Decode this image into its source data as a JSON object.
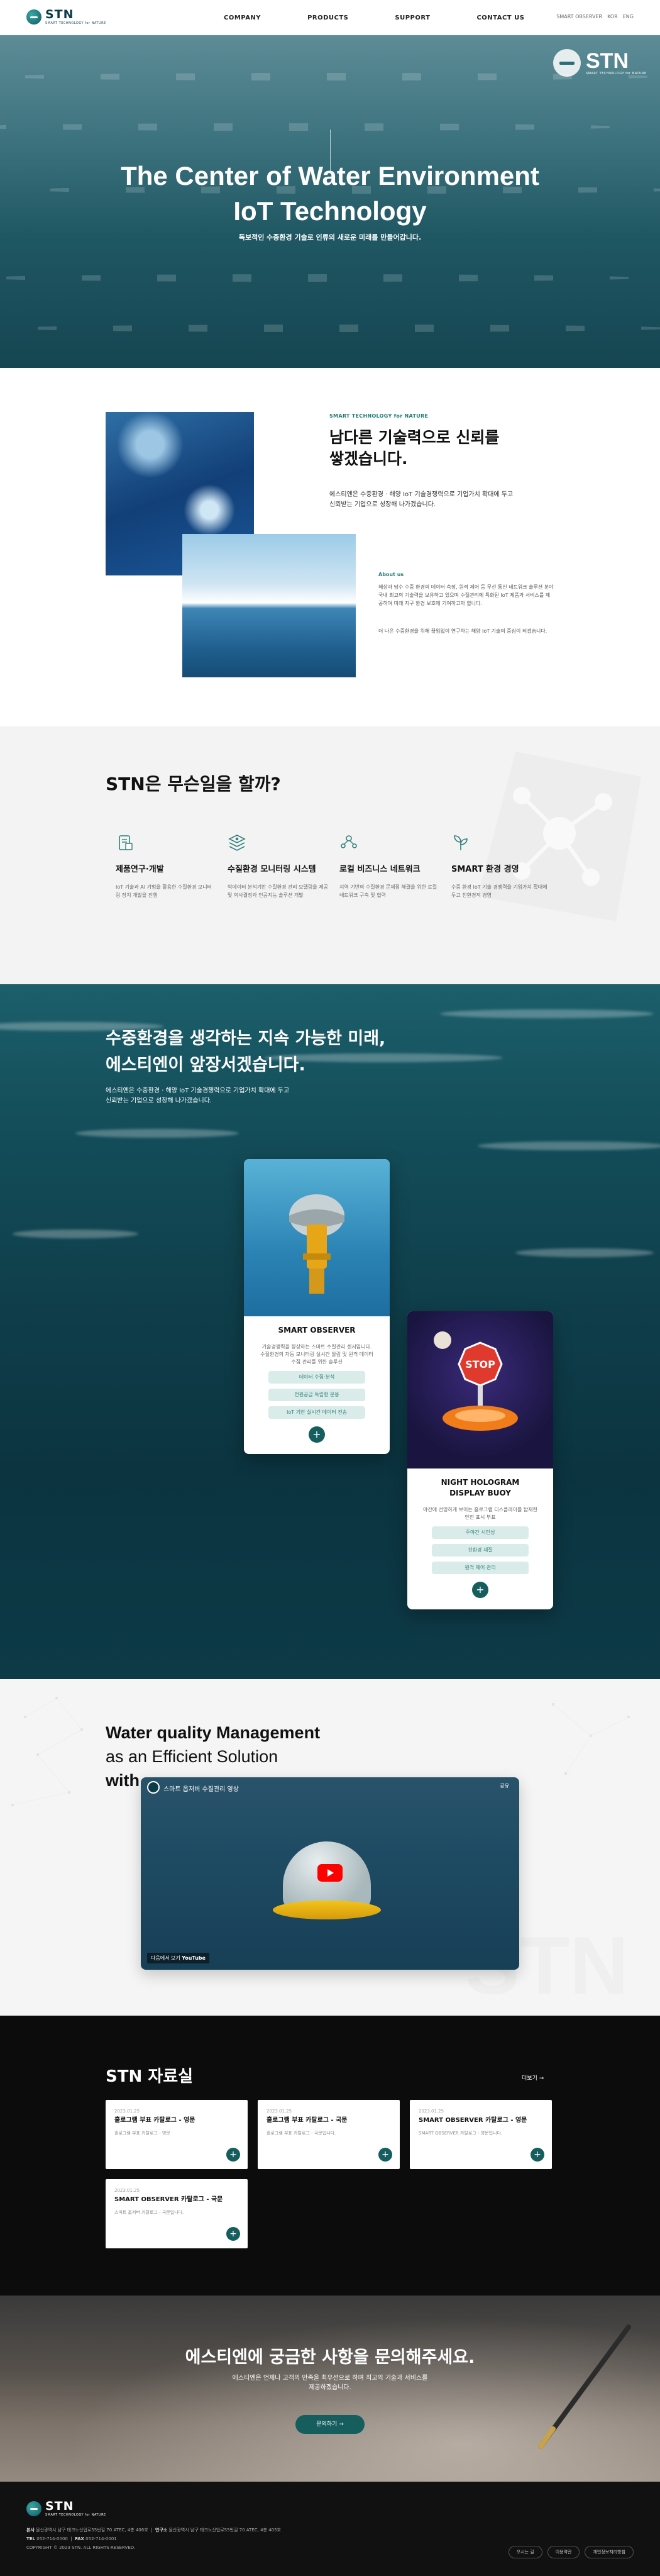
{
  "header": {
    "logo": "STN",
    "logo_sub": "SMART TECHNOLOGY for NATURE",
    "nav": [
      "COMPANY",
      "PRODUCTS",
      "SUPPORT",
      "CONTACT US"
    ],
    "right": [
      "SMART OBSERVER",
      "KOR",
      "ENG"
    ]
  },
  "hero": {
    "title_line1": "The Center of Water Environment",
    "title_line2": "IoT Technology",
    "subtitle": "독보적인 수중환경 기술로 인류의 새로운 미래를 만들어갑니다.",
    "badge_logo": "STN",
    "badge_sub": "SMART TECHNOLOGY for NATURE"
  },
  "about": {
    "kicker": "SMART TECHNOLOGY for NATURE",
    "title_line1": "남다른 기술력으로 신뢰를",
    "title_line2": "쌓겠습니다.",
    "desc_line1": "에스티엔은 수중환경 · 해양 IoT 기술경쟁력으로 기업가치 확대에 두고",
    "desc_line2": "신뢰받는 기업으로 성장해 나가겠습니다.",
    "label": "About us",
    "body": "해상과 담수 수중 환경의 데이터 측정, 원격 제어 등 무선 통신 네트워크 솔루션 분야 국내 최고의 기술력을 보유하고 있으며 수질관리에 특화된 IoT 제품과 서비스를 제공하여 미래 지구 환경 보호에 기여하고자 합니다.",
    "body2": "더 나은 수중환경을 위해 끊임없이 연구하는 해양 IoT 기술의 중심이 되겠습니다."
  },
  "services": {
    "title_plain": "STN은 ",
    "title_bold": "무슨일을 할까?",
    "items": [
      {
        "icon": "document-tablet-icon",
        "name": "제품연구·개발",
        "desc": "IoT 기술과 AI 기법을 활용한 수질환경 모니터링 장치 개발을 진행"
      },
      {
        "icon": "monitoring-network-icon",
        "name": "수질환경 모니터링 시스템",
        "desc": "빅데이터 분석기반 수질환경 관리 모델링을 제공 및 의사결정과 인공지능 솔루션 개발"
      },
      {
        "icon": "people-network-icon",
        "name": "로컬 비즈니스 네트워크",
        "desc": "지역 기반의 수질환경 문제점 해결을 위한 로컬 네트워크 구축 및 협력"
      },
      {
        "icon": "leaf-plant-icon",
        "name": "SMART 환경 경영",
        "desc": "수중 환경 IoT 기술 경쟁력을 기업가치 확대에 두고 친환경적 경영"
      }
    ]
  },
  "products": {
    "title_l1_a": "수중환경",
    "title_l1_b": "을 생각하는 ",
    "title_l1_c": "지속 가능한 미래,",
    "title_l2_a": "에스티엔",
    "title_l2_b": "이 앞장서겠습니다.",
    "desc_line1": "에스티엔은 수중환경 · 해양 IoT 기술경쟁력으로 기업가치 확대에 두고",
    "desc_line2": "신뢰받는 기업으로 성장해 나가겠습니다.",
    "cards": [
      {
        "name": "SMART OBSERVER",
        "desc": "기술경쟁력을 향상하는 스마트 수질관리 센서입니다. 수질환경의 자동 모니터링 실시간 알림 및 원격 데이터 수집 관리를 위한 솔루션",
        "pills": [
          "데이터 수집·분석",
          "전원공급 독립형 운용",
          "IoT 기반 실시간 데이터 전송"
        ]
      },
      {
        "name_line1": "NIGHT HOLOGRAM",
        "name_line2": "DISPLAY BUOY",
        "desc": "야간에 선명하게 보이는 홀로그램 디스플레이를 탑재한 안전 표시 부표",
        "pills": [
          "주야간 시인성",
          "친환경 재질",
          "원격 제어 관리"
        ]
      }
    ]
  },
  "water_quality": {
    "line1": "Water quality Management",
    "line2": "as an Efficient Solution",
    "line3": "with",
    "video_title": "스마트 옵저버 수질관리 영상",
    "video_share": "공유",
    "video_watch": "다음에서 보기",
    "video_brand": "YouTube"
  },
  "downloads": {
    "title_bold": "STN",
    "title_plain": " 자료실",
    "more": "더보기",
    "cards": [
      {
        "date": "2023.01.25",
        "name": "홀로그램 부표 카탈로그 - 영문",
        "summary": "홀로그램 부표 카탈로그 - 영문"
      },
      {
        "date": "2023.01.25",
        "name": "홀로그램 부표 카탈로그 - 국문",
        "summary": "홀로그램 부표 카탈로그 - 국문입니다."
      },
      {
        "date": "2023.01.25",
        "name": "SMART OBSERVER 카탈로그 - 영문",
        "summary": "SMART OBSERVER 카탈로그 - 영문입니다."
      },
      {
        "date": "2023.01.25",
        "name": "SMART OBSERVER 카탈로그 - 국문",
        "summary": "스마트 옵저버 카탈로그 - 국문입니다."
      }
    ]
  },
  "contact": {
    "title_plain1": "에스티엔에 ",
    "title_bold": "궁금한 사항",
    "title_plain2": "을 문의해주세요.",
    "desc_line1": "에스티엔은 언제나 고객의 만족을 최우선으로 하며 최고의 기술과 서비스를",
    "desc_line2": "제공하겠습니다.",
    "button": "문의하기"
  },
  "footer": {
    "logo": "STN",
    "logo_sub": "SMART TECHNOLOGY for NATURE",
    "addr_label": "본사",
    "addr": "울산광역시 남구 테크노산업로55번길 70 ATEC, 4층 406호",
    "lab_label": "연구소",
    "lab": "울산광역시 남구 테크노산업로55번길 70 ATEC, 4층 405호",
    "tel_label": "TEL",
    "tel": "052-714-0000",
    "fax_label": "FAX",
    "fax": "052-714-0001",
    "copyright": "COPYRIGHT © 2023 STN. ALL RIGHTS RESERVED.",
    "links": [
      "오시는 길",
      "이용약관",
      "개인정보처리방침"
    ]
  }
}
